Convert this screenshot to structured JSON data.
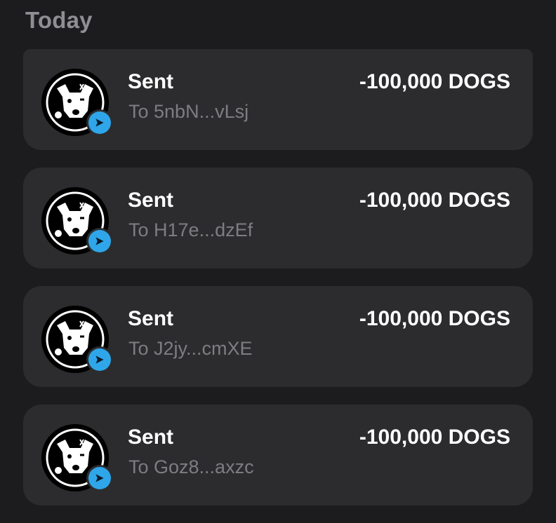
{
  "section": {
    "title": "Today"
  },
  "transactions": [
    {
      "title": "Sent",
      "recipient": "To 5nbN...vLsj",
      "amount": "-100,000 DOGS",
      "avatar_icon": "dogs-token-icon",
      "badge_icon": "telegram-send-icon"
    },
    {
      "title": "Sent",
      "recipient": "To H17e...dzEf",
      "amount": "-100,000 DOGS",
      "avatar_icon": "dogs-token-icon",
      "badge_icon": "telegram-send-icon"
    },
    {
      "title": "Sent",
      "recipient": "To J2jy...cmXE",
      "amount": "-100,000 DOGS",
      "avatar_icon": "dogs-token-icon",
      "badge_icon": "telegram-send-icon"
    },
    {
      "title": "Sent",
      "recipient": "To Goz8...axzc",
      "amount": "-100,000 DOGS",
      "avatar_icon": "dogs-token-icon",
      "badge_icon": "telegram-send-icon"
    }
  ],
  "colors": {
    "background": "#1c1c1e",
    "card": "#2c2c2e",
    "badge_accent": "#2ea6e9",
    "secondary_text": "#7d7d82"
  }
}
